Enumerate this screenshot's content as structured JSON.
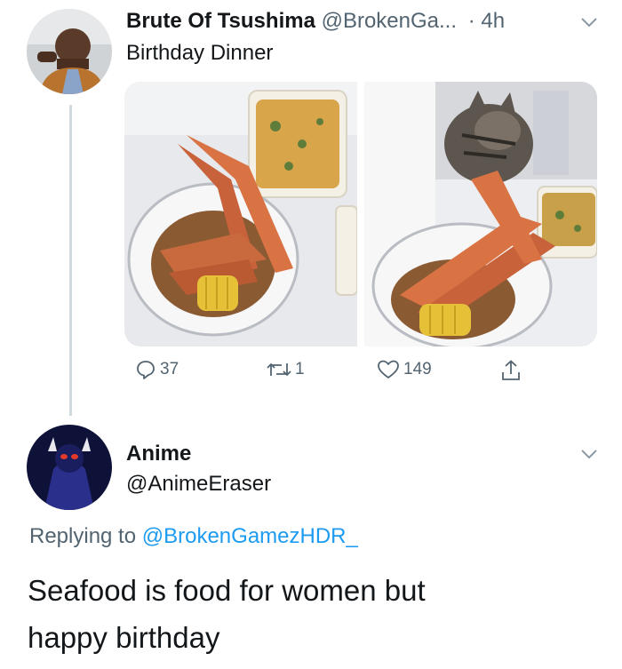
{
  "original_tweet": {
    "author_name": "Brute Of Tsushima",
    "author_handle": "@BrokenGa...",
    "time": "· 4h",
    "text": "Birthday Dinner",
    "stats": {
      "replies": "37",
      "retweets": "1",
      "likes": "149"
    },
    "icons": [
      "reply-icon",
      "retweet-icon",
      "like-icon",
      "share-icon",
      "chevron-down-icon"
    ]
  },
  "reply_tweet": {
    "author_name": "Anime",
    "author_handle": "@AnimeEraser",
    "replying_label": "Replying to",
    "replying_mention": "@BrokenGamezHDR_",
    "text_line_1": "Seafood is food for women but",
    "text_line_2": "happy birthday"
  },
  "colors": {
    "text": "#14171a",
    "secondary": "#536471",
    "link": "#1d9bf0",
    "thread_line": "#cfd9de"
  }
}
